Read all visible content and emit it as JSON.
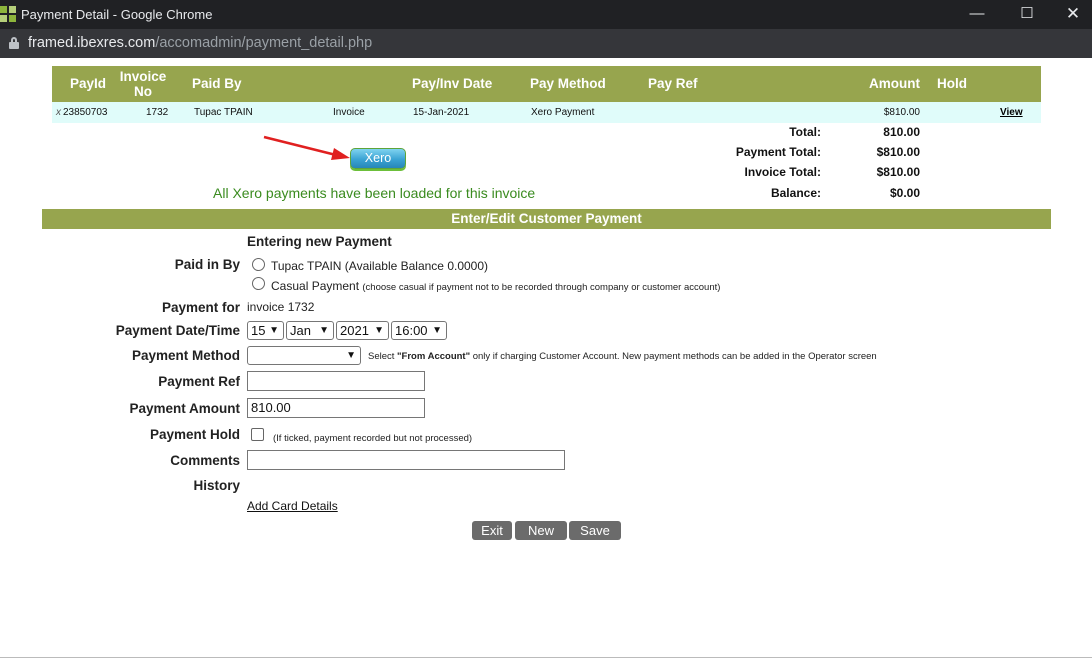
{
  "window": {
    "title": "Payment Detail - Google Chrome"
  },
  "address": {
    "domain": "framed.ibexres.com",
    "path": "/accomadmin/payment_detail.php"
  },
  "table": {
    "headers": {
      "payid": "PayId",
      "invoice_no": "Invoice No",
      "paid_by": "Paid By",
      "pay_inv_date": "Pay/Inv Date",
      "pay_method": "Pay Method",
      "pay_ref": "Pay Ref",
      "amount": "Amount",
      "hold": "Hold"
    },
    "row": {
      "marker": "x",
      "payid": "23850703",
      "invoice_no": "1732",
      "paid_by": "Tupac TPAIN",
      "type": "Invoice",
      "date": "15-Jan-2021",
      "method": "Xero Payment",
      "amount": "$810.00",
      "view": "View"
    }
  },
  "totals": {
    "total_label": "Total:",
    "total_value": "810.00",
    "payment_total_label": "Payment Total:",
    "payment_total_value": "$810.00",
    "invoice_total_label": "Invoice Total:",
    "invoice_total_value": "$810.00",
    "balance_label": "Balance:",
    "balance_value": "$0.00"
  },
  "xero": {
    "button_label": "Xero",
    "message": "All Xero payments have been loaded for this invoice"
  },
  "section": {
    "title": "Enter/Edit Customer Payment"
  },
  "form": {
    "subtitle": "Entering new Payment",
    "paid_in_by_label": "Paid in By",
    "radio1_label": "Tupac TPAIN (Available Balance 0.0000)",
    "radio2_label": "Casual Payment",
    "radio2_note": "(choose casual if payment not to be recorded through company or customer account)",
    "payment_for_label": "Payment for",
    "payment_for_value": "invoice 1732",
    "date_label": "Payment Date/Time",
    "day": "15",
    "month": "Jan",
    "year": "2021",
    "time": "16:00",
    "method_label": "Payment Method",
    "method_value": "",
    "method_note_pre": "Select ",
    "method_note_bold": "\"From Account\"",
    "method_note_post": " only if charging Customer Account.   New payment methods can be added in the Operator screen",
    "ref_label": "Payment Ref",
    "ref_value": "",
    "amount_label": "Payment Amount",
    "amount_value": "810.00",
    "hold_label": "Payment Hold",
    "hold_note": "(If ticked, payment recorded but not processed)",
    "comments_label": "Comments",
    "comments_value": "",
    "history_label": "History",
    "add_card_link": "Add Card Details"
  },
  "buttons": {
    "exit": "Exit",
    "new": "New",
    "save": "Save"
  },
  "colors": {
    "header_green": "#97a54e",
    "row_cyan": "#e0fcfa",
    "message_green": "#3a8b1f",
    "arrow_red": "#e02020"
  }
}
